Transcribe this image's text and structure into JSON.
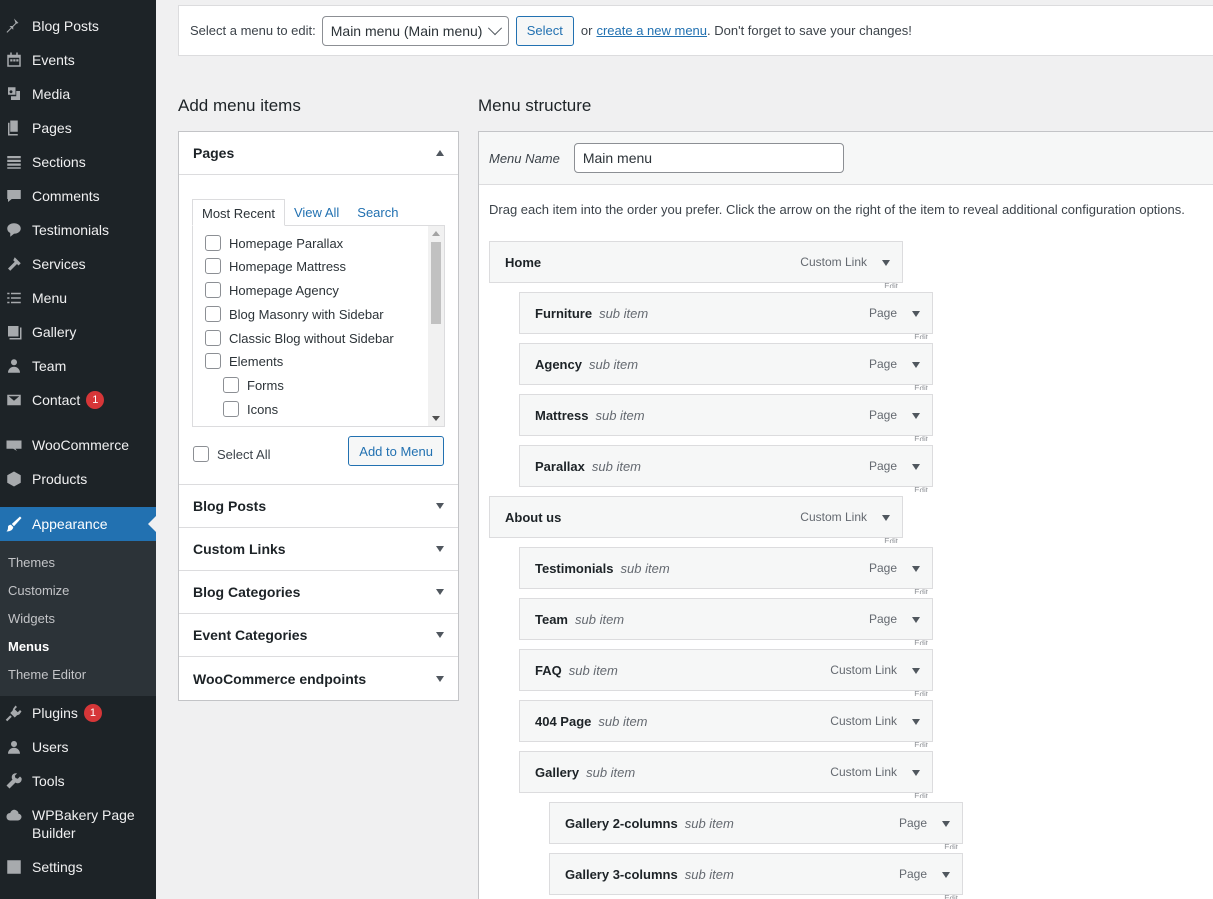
{
  "sidebar": {
    "items": [
      {
        "label": "Blog Posts",
        "icon": "pushpin-icon"
      },
      {
        "label": "Events",
        "icon": "calendar-icon"
      },
      {
        "label": "Media",
        "icon": "media-icon"
      },
      {
        "label": "Pages",
        "icon": "pages-icon"
      },
      {
        "label": "Sections",
        "icon": "sections-icon"
      },
      {
        "label": "Comments",
        "icon": "comment-icon"
      },
      {
        "label": "Testimonials",
        "icon": "testimonial-icon"
      },
      {
        "label": "Services",
        "icon": "hammer-icon"
      },
      {
        "label": "Menu",
        "icon": "list-icon"
      },
      {
        "label": "Gallery",
        "icon": "gallery-icon"
      },
      {
        "label": "Team",
        "icon": "user-icon"
      },
      {
        "label": "Contact",
        "icon": "mail-icon",
        "badge": "1"
      },
      {
        "label": "WooCommerce",
        "icon": "woo-icon"
      },
      {
        "label": "Products",
        "icon": "box-icon"
      },
      {
        "label": "Appearance",
        "icon": "brush-icon"
      },
      {
        "label": "Plugins",
        "icon": "plugin-icon",
        "badge": "1"
      },
      {
        "label": "Users",
        "icon": "users-icon"
      },
      {
        "label": "Tools",
        "icon": "wrench-icon"
      },
      {
        "label": "WPBakery Page Builder",
        "icon": "cloud-icon"
      },
      {
        "label": "Settings",
        "icon": "settings-icon"
      }
    ],
    "submenu": [
      "Themes",
      "Customize",
      "Widgets",
      "Menus",
      "Theme Editor"
    ]
  },
  "topbar": {
    "prompt": "Select a menu to edit:",
    "selected_menu": "Main menu (Main menu)",
    "select_button": "Select",
    "or_text": "or",
    "create_link": "create a new menu",
    "tail_text": ". Don't forget to save your changes!"
  },
  "add_items": {
    "heading": "Add menu items",
    "pages": {
      "title": "Pages",
      "tabs": [
        "Most Recent",
        "View All",
        "Search"
      ],
      "items": [
        "Homepage Parallax",
        "Homepage Mattress",
        "Homepage Agency",
        "Blog Masonry with Sidebar",
        "Classic Blog without Sidebar",
        "Elements",
        "Forms",
        "Icons"
      ],
      "select_all": "Select All",
      "add_button": "Add to Menu"
    },
    "sections": [
      "Blog Posts",
      "Custom Links",
      "Blog Categories",
      "Event Categories",
      "WooCommerce endpoints"
    ]
  },
  "structure": {
    "heading": "Menu structure",
    "name_label": "Menu Name",
    "name_value": "Main menu",
    "instructions": "Drag each item into the order you prefer. Click the arrow on the right of the item to reveal additional configuration options.",
    "edit_label": "Edit",
    "items": [
      {
        "title": "Home",
        "sub": "",
        "type": "Custom Link",
        "depth": 0
      },
      {
        "title": "Furniture",
        "sub": "sub item",
        "type": "Page",
        "depth": 1
      },
      {
        "title": "Agency",
        "sub": "sub item",
        "type": "Page",
        "depth": 1
      },
      {
        "title": "Mattress",
        "sub": "sub item",
        "type": "Page",
        "depth": 1
      },
      {
        "title": "Parallax",
        "sub": "sub item",
        "type": "Page",
        "depth": 1
      },
      {
        "title": "About us",
        "sub": "",
        "type": "Custom Link",
        "depth": 0
      },
      {
        "title": "Testimonials",
        "sub": "sub item",
        "type": "Page",
        "depth": 1
      },
      {
        "title": "Team",
        "sub": "sub item",
        "type": "Page",
        "depth": 1
      },
      {
        "title": "FAQ",
        "sub": "sub item",
        "type": "Custom Link",
        "depth": 1
      },
      {
        "title": "404 Page",
        "sub": "sub item",
        "type": "Custom Link",
        "depth": 1
      },
      {
        "title": "Gallery",
        "sub": "sub item",
        "type": "Custom Link",
        "depth": 1
      },
      {
        "title": "Gallery 2-columns",
        "sub": "sub item",
        "type": "Page",
        "depth": 2
      },
      {
        "title": "Gallery 3-columns",
        "sub": "sub item",
        "type": "Page",
        "depth": 2
      }
    ]
  },
  "colors": {
    "sidebar_bg": "#1d2327",
    "accent": "#2271b1",
    "badge": "#d63638"
  }
}
